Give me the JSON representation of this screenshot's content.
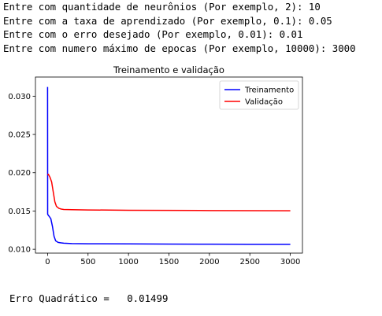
{
  "console": {
    "lines": [
      "Entre com quantidade de neurônios (Por exemplo, 2): 10",
      "Entre com a taxa de aprendizado (Por exemplo, 0.1): 0.05",
      "Entre com o erro desejado (Por exemplo, 0.01): 0.01",
      "Entre com numero máximo de epocas (Por exemplo, 10000): 3000"
    ]
  },
  "chart_data": {
    "type": "line",
    "title": "Treinamento e validação",
    "xlabel": "",
    "ylabel": "",
    "xlim": [
      -150,
      3150
    ],
    "ylim": [
      0.0095,
      0.0325
    ],
    "x_ticks": [
      0,
      500,
      1000,
      1500,
      2000,
      2500,
      3000
    ],
    "y_ticks": [
      0.01,
      0.015,
      0.02,
      0.025,
      0.03
    ],
    "y_tick_labels": [
      "0.010",
      "0.015",
      "0.020",
      "0.025",
      "0.030"
    ],
    "grid": false,
    "legend_position": "top-right",
    "series": [
      {
        "name": "Treinamento",
        "color": "#0000ff",
        "x": [
          0,
          1,
          5,
          20,
          40,
          60,
          80,
          100,
          130,
          160,
          200,
          300,
          500,
          1000,
          1500,
          2000,
          2500,
          3000
        ],
        "y": [
          0.0312,
          0.0146,
          0.0145,
          0.0143,
          0.014,
          0.013,
          0.0117,
          0.0111,
          0.0109,
          0.01085,
          0.0108,
          0.01075,
          0.01072,
          0.0107,
          0.01068,
          0.01067,
          0.01066,
          0.01065
        ]
      },
      {
        "name": "Validação",
        "color": "#ff0000",
        "x": [
          0,
          10,
          30,
          50,
          70,
          90,
          110,
          140,
          170,
          200,
          300,
          500,
          1000,
          1500,
          2000,
          2500,
          3000
        ],
        "y": [
          0.0197,
          0.0198,
          0.0194,
          0.0188,
          0.0175,
          0.0162,
          0.0156,
          0.01535,
          0.01525,
          0.0152,
          0.01517,
          0.01514,
          0.0151,
          0.01508,
          0.01506,
          0.01504,
          0.01503
        ]
      }
    ]
  },
  "result": {
    "text": "Erro Quadrático =   0.01499"
  }
}
